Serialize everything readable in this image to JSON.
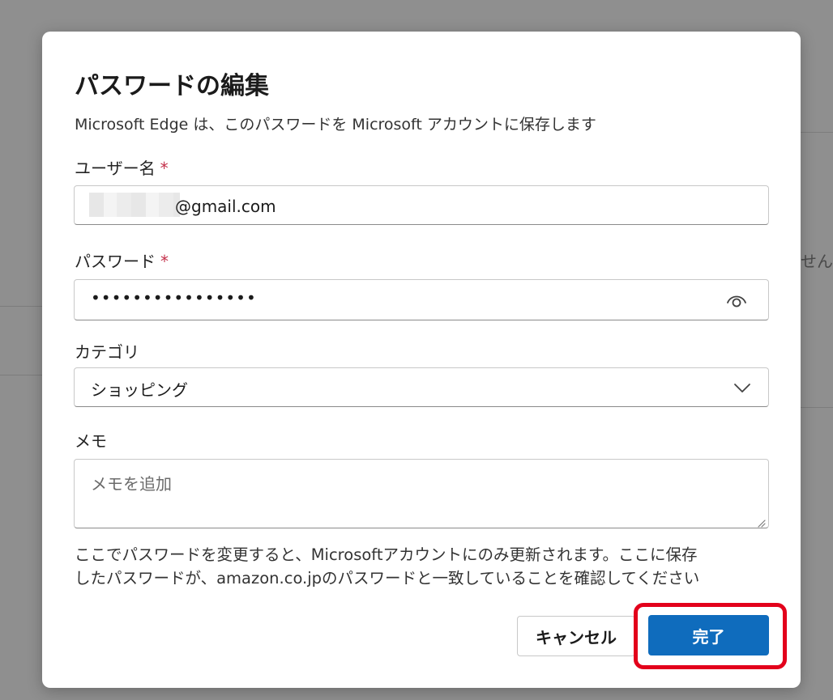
{
  "dialog": {
    "title": "パスワードの編集",
    "subtitle": "Microsoft Edge は、このパスワードを Microsoft アカウントに保存します",
    "username": {
      "label": "ユーザー名",
      "required_mark": "*",
      "value_visible_part": "@gmail.com"
    },
    "password": {
      "label": "パスワード",
      "required_mark": "*",
      "masked_value": "••••••••••••••••",
      "reveal_icon": "eye-icon"
    },
    "category": {
      "label": "カテゴリ",
      "selected": "ショッピング",
      "dropdown_icon": "chevron-down-icon"
    },
    "notes": {
      "label": "メモ",
      "placeholder": "メモを追加"
    },
    "info": {
      "line1": "ここでパスワードを変更すると、Microsoftアカウントにのみ更新されます。ここに保存",
      "line2": "したパスワードが、amazon.co.jpのパスワードと一致していることを確認してください"
    },
    "buttons": {
      "cancel": "キャンセル",
      "done": "完了"
    }
  },
  "background": {
    "partial_text": "せん"
  },
  "colors": {
    "primary_button": "#0f6cbd",
    "required_mark": "#c4314b",
    "highlight_frame": "#e3001b",
    "overlay": "#8f8f8f"
  }
}
